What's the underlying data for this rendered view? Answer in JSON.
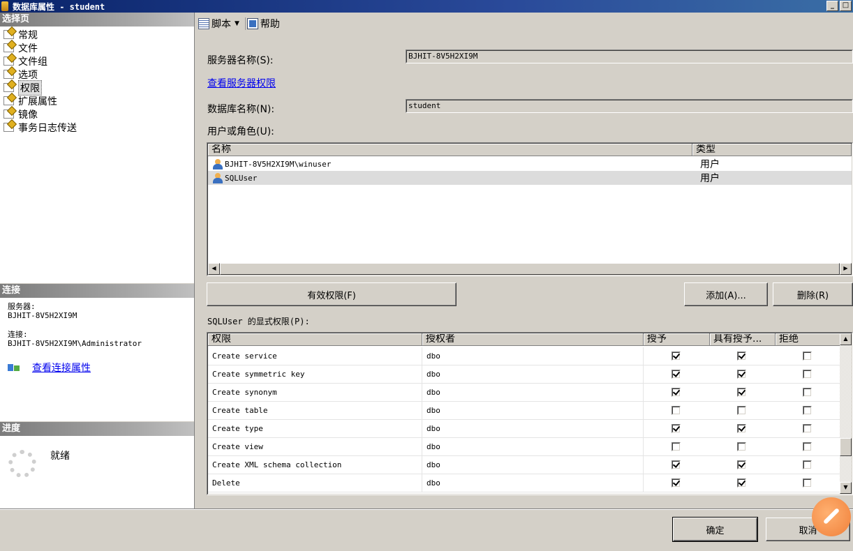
{
  "window": {
    "title": "数据库属性 - student",
    "minimize": "_",
    "restore": "□"
  },
  "left": {
    "pages_header": "选择页",
    "pages": [
      {
        "label": "常规"
      },
      {
        "label": "文件"
      },
      {
        "label": "文件组"
      },
      {
        "label": "选项"
      },
      {
        "label": "权限"
      },
      {
        "label": "扩展属性"
      },
      {
        "label": "镜像"
      },
      {
        "label": "事务日志传送"
      }
    ],
    "selected_page": "权限",
    "connection_header": "连接",
    "server_label": "服务器:",
    "server_value": "BJHIT-8V5H2XI9M",
    "connection_label": "连接:",
    "connection_value": "BJHIT-8V5H2XI9M\\Administrator",
    "view_conn_props": "查看连接属性",
    "progress_header": "进度",
    "progress_status": "就绪"
  },
  "toolbar": {
    "script_label": "脚本",
    "help_label": "帮助"
  },
  "form": {
    "server_name_label": "服务器名称(S):",
    "server_name_value": "BJHIT-8V5H2XI9M",
    "view_server_perms": "查看服务器权限",
    "db_name_label": "数据库名称(N):",
    "db_name_value": "student",
    "users_label": "用户或角色(U):"
  },
  "users_grid": {
    "columns": [
      "名称",
      "类型"
    ],
    "rows": [
      {
        "name": "BJHIT-8V5H2XI9M\\winuser",
        "type": "用户"
      },
      {
        "name": "SQLUser",
        "type": "用户"
      }
    ]
  },
  "buttons": {
    "effective_perms": "有效权限(F)",
    "add": "添加(A)...",
    "remove": "删除(R)",
    "ok": "确定",
    "cancel": "取消"
  },
  "perms": {
    "label": "SQLUser 的显式权限(P):",
    "columns": [
      "权限",
      "授权者",
      "授予",
      "具有授予...",
      "拒绝"
    ],
    "rows": [
      {
        "permission": "Create service",
        "grantor": "dbo",
        "grant": true,
        "with_grant": true,
        "deny": false
      },
      {
        "permission": "Create symmetric key",
        "grantor": "dbo",
        "grant": true,
        "with_grant": true,
        "deny": false
      },
      {
        "permission": "Create synonym",
        "grantor": "dbo",
        "grant": true,
        "with_grant": true,
        "deny": false
      },
      {
        "permission": "Create table",
        "grantor": "dbo",
        "grant": false,
        "with_grant": false,
        "deny": false
      },
      {
        "permission": "Create type",
        "grantor": "dbo",
        "grant": true,
        "with_grant": true,
        "deny": false
      },
      {
        "permission": "Create view",
        "grantor": "dbo",
        "grant": false,
        "with_grant": false,
        "deny": false
      },
      {
        "permission": "Create XML schema collection",
        "grantor": "dbo",
        "grant": true,
        "with_grant": true,
        "deny": false
      },
      {
        "permission": "Delete",
        "grantor": "dbo",
        "grant": true,
        "with_grant": true,
        "deny": false
      }
    ]
  }
}
